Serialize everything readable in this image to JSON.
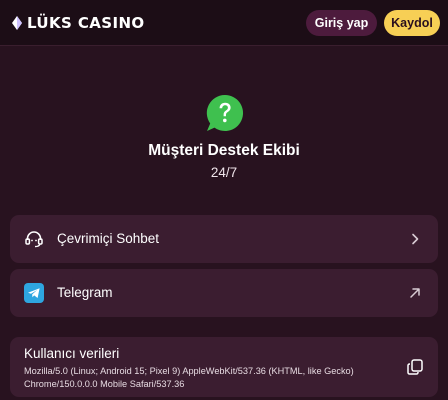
{
  "header": {
    "logo_text": "LÜKS CASINO",
    "logo_icon": "diamond-icon",
    "login_label": "Giriş yap",
    "signup_label": "Kaydol"
  },
  "support": {
    "icon": "whatsapp-question-icon",
    "title": "Müşteri Destek Ekibi",
    "hours": "24/7"
  },
  "channels": [
    {
      "label": "Çevrimiçi Sohbet",
      "icon": "headset-icon",
      "action_icon": "chevron-right-icon"
    },
    {
      "label": "Telegram",
      "icon": "telegram-icon",
      "action_icon": "external-link-arrow-icon"
    }
  ],
  "user_data": {
    "title": "Kullanıcı verileri",
    "user_agent": "Mozilla/5.0 (Linux; Android 15; Pixel 9) AppleWebKit/537.36 (KHTML, like Gecko) Chrome/150.0.0.0 Mobile Safari/537.36",
    "copy_icon": "copy-icon"
  },
  "colors": {
    "background": "#28121f",
    "header": "#1c0d16",
    "card": "#3b1d30",
    "login_button": "#4d1b3d",
    "signup_button": "#f7cf55",
    "whatsapp_green": "#3fc04f",
    "telegram_blue": "#2ea6e0"
  }
}
